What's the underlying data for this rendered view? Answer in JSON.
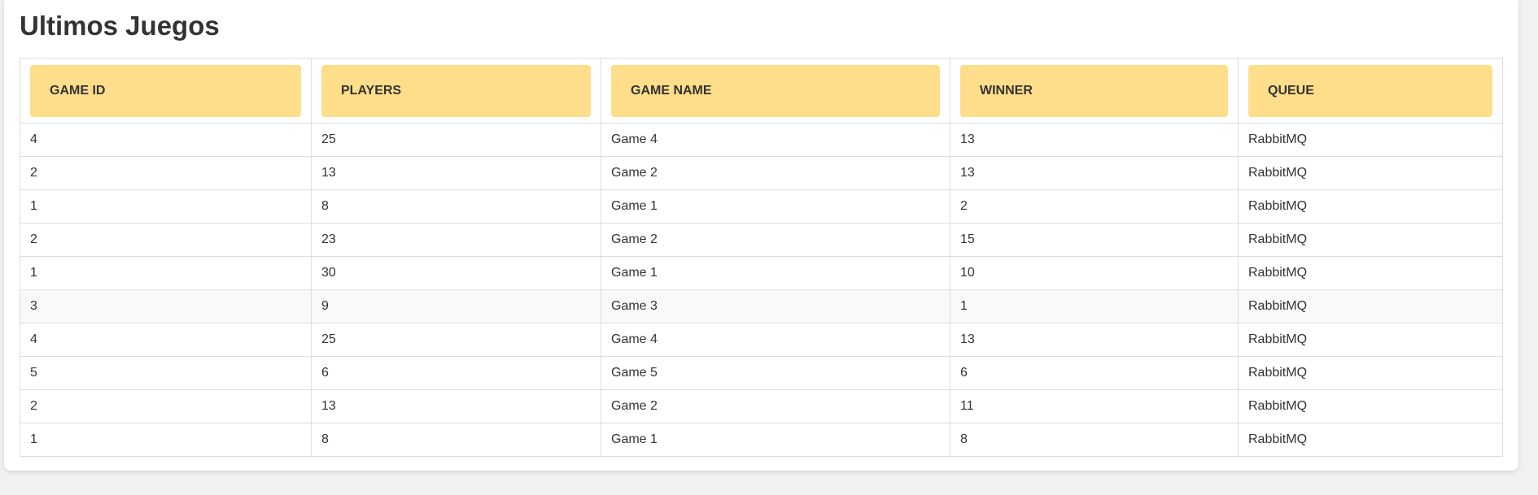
{
  "title": "Ultimos Juegos",
  "table": {
    "headers": [
      "GAME ID",
      "PLAYERS",
      "GAME NAME",
      "WINNER",
      "QUEUE"
    ],
    "rows": [
      [
        "4",
        "25",
        "Game 4",
        "13",
        "RabbitMQ"
      ],
      [
        "2",
        "13",
        "Game 2",
        "13",
        "RabbitMQ"
      ],
      [
        "1",
        "8",
        "Game 1",
        "2",
        "RabbitMQ"
      ],
      [
        "2",
        "23",
        "Game 2",
        "15",
        "RabbitMQ"
      ],
      [
        "1",
        "30",
        "Game 1",
        "10",
        "RabbitMQ"
      ],
      [
        "3",
        "9",
        "Game 3",
        "1",
        "RabbitMQ"
      ],
      [
        "4",
        "25",
        "Game 4",
        "13",
        "RabbitMQ"
      ],
      [
        "5",
        "6",
        "Game 5",
        "6",
        "RabbitMQ"
      ],
      [
        "2",
        "13",
        "Game 2",
        "11",
        "RabbitMQ"
      ],
      [
        "1",
        "8",
        "Game 1",
        "8",
        "RabbitMQ"
      ]
    ]
  },
  "colors": {
    "header_bg": "#fede8a",
    "hover_row_bg": "#f9f9f9",
    "border": "#dddddd"
  }
}
